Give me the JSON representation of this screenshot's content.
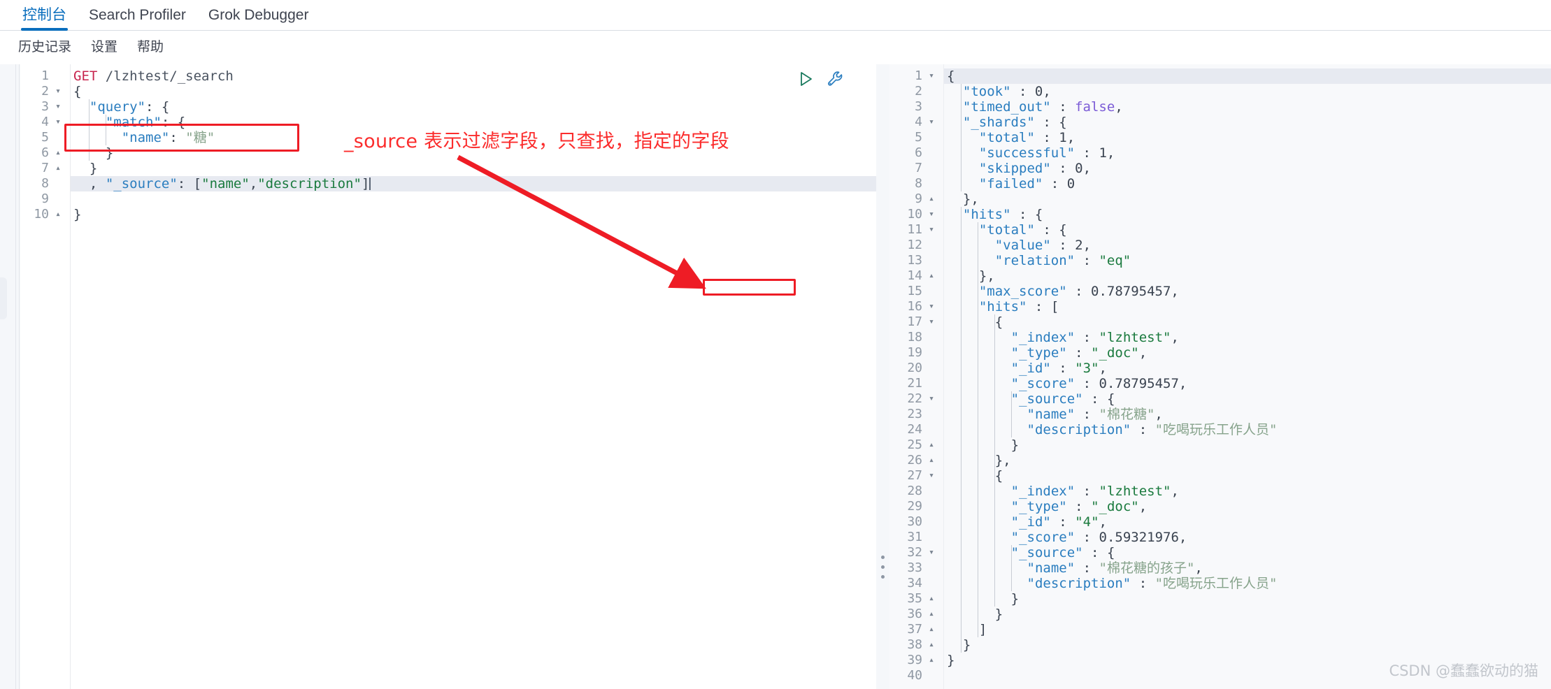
{
  "tabs": [
    {
      "label": "控制台",
      "active": true
    },
    {
      "label": "Search Profiler",
      "active": false
    },
    {
      "label": "Grok Debugger",
      "active": false
    }
  ],
  "submenu": [
    {
      "label": "历史记录"
    },
    {
      "label": "设置"
    },
    {
      "label": "帮助"
    }
  ],
  "editor_tools": [
    {
      "name": "play-icon",
      "title": "发送请求"
    },
    {
      "name": "wrench-icon",
      "title": "工具"
    }
  ],
  "request_editor": {
    "lines": [
      {
        "n": 1,
        "fold": "",
        "text": "GET /lzhtest/_search"
      },
      {
        "n": 2,
        "fold": "▾",
        "text": "{"
      },
      {
        "n": 3,
        "fold": "▾",
        "text": "  \"query\": {"
      },
      {
        "n": 4,
        "fold": "▾",
        "text": "    \"match\": {"
      },
      {
        "n": 5,
        "fold": "",
        "text": "      \"name\": \"糖\""
      },
      {
        "n": 6,
        "fold": "▴",
        "text": "    }"
      },
      {
        "n": 7,
        "fold": "▴",
        "text": "  }"
      },
      {
        "n": 8,
        "fold": "",
        "text": "  , \"_source\": [\"name\",\"description\"]"
      },
      {
        "n": 9,
        "fold": "",
        "text": ""
      },
      {
        "n": 10,
        "fold": "▴",
        "text": "}"
      }
    ],
    "active_line": 8
  },
  "response_viewer": {
    "lines": [
      {
        "n": 1,
        "fold": "▾",
        "text": "{"
      },
      {
        "n": 2,
        "fold": "",
        "text": "  \"took\" : 0,"
      },
      {
        "n": 3,
        "fold": "",
        "text": "  \"timed_out\" : false,"
      },
      {
        "n": 4,
        "fold": "▾",
        "text": "  \"_shards\" : {"
      },
      {
        "n": 5,
        "fold": "",
        "text": "    \"total\" : 1,"
      },
      {
        "n": 6,
        "fold": "",
        "text": "    \"successful\" : 1,"
      },
      {
        "n": 7,
        "fold": "",
        "text": "    \"skipped\" : 0,"
      },
      {
        "n": 8,
        "fold": "",
        "text": "    \"failed\" : 0"
      },
      {
        "n": 9,
        "fold": "▴",
        "text": "  },"
      },
      {
        "n": 10,
        "fold": "▾",
        "text": "  \"hits\" : {"
      },
      {
        "n": 11,
        "fold": "▾",
        "text": "    \"total\" : {"
      },
      {
        "n": 12,
        "fold": "",
        "text": "      \"value\" : 2,"
      },
      {
        "n": 13,
        "fold": "",
        "text": "      \"relation\" : \"eq\""
      },
      {
        "n": 14,
        "fold": "▴",
        "text": "    },"
      },
      {
        "n": 15,
        "fold": "",
        "text": "    \"max_score\" : 0.78795457,"
      },
      {
        "n": 16,
        "fold": "▾",
        "text": "    \"hits\" : ["
      },
      {
        "n": 17,
        "fold": "▾",
        "text": "      {"
      },
      {
        "n": 18,
        "fold": "",
        "text": "        \"_index\" : \"lzhtest\","
      },
      {
        "n": 19,
        "fold": "",
        "text": "        \"_type\" : \"_doc\","
      },
      {
        "n": 20,
        "fold": "",
        "text": "        \"_id\" : \"3\","
      },
      {
        "n": 21,
        "fold": "",
        "text": "        \"_score\" : 0.78795457,"
      },
      {
        "n": 22,
        "fold": "▾",
        "text": "        \"_source\" : {"
      },
      {
        "n": 23,
        "fold": "",
        "text": "          \"name\" : \"棉花糖\","
      },
      {
        "n": 24,
        "fold": "",
        "text": "          \"description\" : \"吃喝玩乐工作人员\""
      },
      {
        "n": 25,
        "fold": "▴",
        "text": "        }"
      },
      {
        "n": 26,
        "fold": "▴",
        "text": "      },"
      },
      {
        "n": 27,
        "fold": "▾",
        "text": "      {"
      },
      {
        "n": 28,
        "fold": "",
        "text": "        \"_index\" : \"lzhtest\","
      },
      {
        "n": 29,
        "fold": "",
        "text": "        \"_type\" : \"_doc\","
      },
      {
        "n": 30,
        "fold": "",
        "text": "        \"_id\" : \"4\","
      },
      {
        "n": 31,
        "fold": "",
        "text": "        \"_score\" : 0.59321976,"
      },
      {
        "n": 32,
        "fold": "▾",
        "text": "        \"_source\" : {"
      },
      {
        "n": 33,
        "fold": "",
        "text": "          \"name\" : \"棉花糖的孩子\","
      },
      {
        "n": 34,
        "fold": "",
        "text": "          \"description\" : \"吃喝玩乐工作人员\""
      },
      {
        "n": 35,
        "fold": "▴",
        "text": "        }"
      },
      {
        "n": 36,
        "fold": "▴",
        "text": "      }"
      },
      {
        "n": 37,
        "fold": "▴",
        "text": "    ]"
      },
      {
        "n": 38,
        "fold": "▴",
        "text": "  }"
      },
      {
        "n": 39,
        "fold": "▴",
        "text": "}"
      },
      {
        "n": 40,
        "fold": "",
        "text": ""
      }
    ],
    "active_line": 1
  },
  "annotations": {
    "note_text": "_source 表示过滤字段，只查找，指定的字段",
    "note_color": "#fb2c2c",
    "box_color": "#ee1c25"
  },
  "watermark": "CSDN @蠢蠢欲动的猫"
}
